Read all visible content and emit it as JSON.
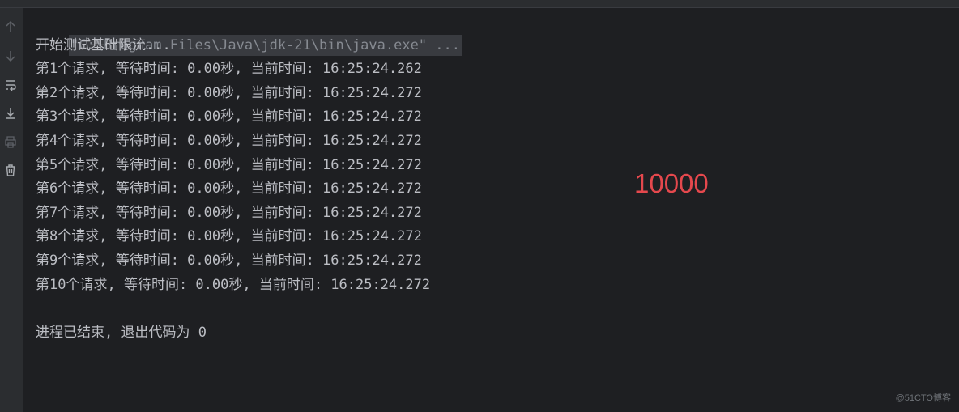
{
  "console": {
    "command": "\"C:\\Program Files\\Java\\jdk-21\\bin\\java.exe\" ...",
    "lines": [
      "开始测试基础限流...",
      "第1个请求, 等待时间: 0.00秒, 当前时间: 16:25:24.262",
      "第2个请求, 等待时间: 0.00秒, 当前时间: 16:25:24.272",
      "第3个请求, 等待时间: 0.00秒, 当前时间: 16:25:24.272",
      "第4个请求, 等待时间: 0.00秒, 当前时间: 16:25:24.272",
      "第5个请求, 等待时间: 0.00秒, 当前时间: 16:25:24.272",
      "第6个请求, 等待时间: 0.00秒, 当前时间: 16:25:24.272",
      "第7个请求, 等待时间: 0.00秒, 当前时间: 16:25:24.272",
      "第8个请求, 等待时间: 0.00秒, 当前时间: 16:25:24.272",
      "第9个请求, 等待时间: 0.00秒, 当前时间: 16:25:24.272",
      "第10个请求, 等待时间: 0.00秒, 当前时间: 16:25:24.272"
    ],
    "exit_message": "进程已结束, 退出代码为 0"
  },
  "annotation": "10000",
  "watermark": "@51CTO博客",
  "gutter_icons": [
    "arrow-up-icon",
    "arrow-down-icon",
    "soft-wrap-icon",
    "scroll-to-end-icon",
    "print-icon",
    "trash-icon"
  ],
  "colors": {
    "background": "#1e1f22",
    "gutter": "#2b2d30",
    "text": "#bcbec4",
    "command_highlight": "#393b40",
    "annotation": "#e5484d"
  }
}
